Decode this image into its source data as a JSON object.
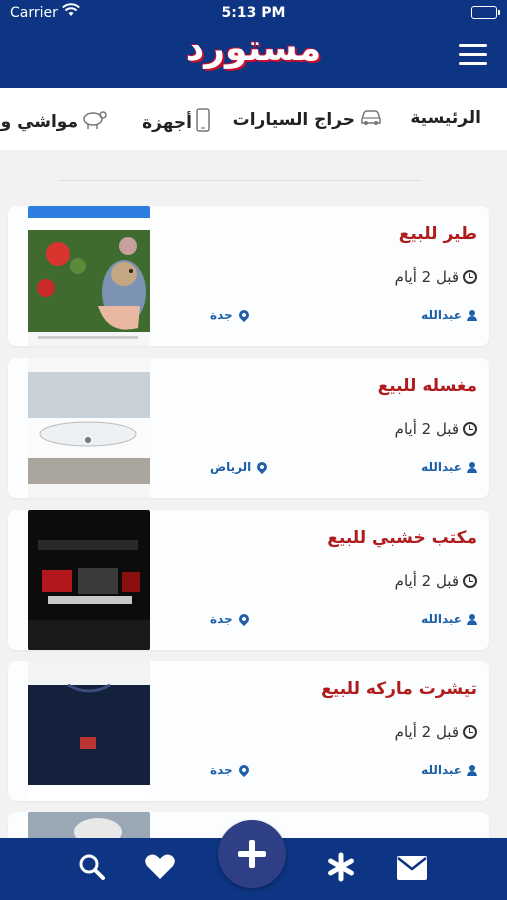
{
  "status_bar": {
    "carrier": "Carrier",
    "time": "5:13 PM"
  },
  "header": {
    "logo": "مستورد",
    "menu_icon": "hamburger-menu-icon"
  },
  "categories": [
    {
      "label": "الرئيسية",
      "icon": ""
    },
    {
      "label": "حراج السيارات",
      "icon": "car-icon"
    },
    {
      "label": "أجهزة",
      "icon": "phone-icon"
    },
    {
      "label": "مواشي و",
      "icon": "sheep-icon"
    }
  ],
  "listings": [
    {
      "title": "طير للبيع",
      "time": "قبل 2 أيام",
      "user": "عبدالله",
      "location": "جدة",
      "image": "bird-photo"
    },
    {
      "title": "مغسله للبيع",
      "time": "قبل 2 أيام",
      "user": "عبدالله",
      "location": "الرياض",
      "image": "sink-photo"
    },
    {
      "title": "مكتب خشبي للبيع",
      "time": "قبل 2 أيام",
      "user": "عبدالله",
      "location": "جدة",
      "image": "office-photo"
    },
    {
      "title": "تيشرت ماركه للبيع",
      "time": "قبل 2 أيام",
      "user": "عبدالله",
      "location": "جدة",
      "image": "tshirt-photo"
    }
  ],
  "bottom_nav": {
    "items": [
      "search-icon",
      "heart-icon",
      "add-icon",
      "asterisk-icon",
      "mail-icon"
    ],
    "accent": "#0d3584"
  },
  "colors": {
    "brand": "#0d3584",
    "title_red": "#b01c1c",
    "meta_blue": "#1f5fa8"
  }
}
